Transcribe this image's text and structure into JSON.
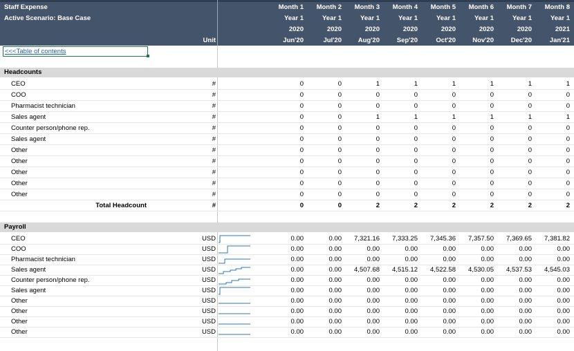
{
  "header": {
    "title": "Staff Expense",
    "scenario": "Active Scenario: Base Case",
    "unit_label": "Unit",
    "months": [
      {
        "m": "Month 1",
        "y": "Year 1",
        "yr": "2020",
        "d": "Jun'20"
      },
      {
        "m": "Month 2",
        "y": "Year 1",
        "yr": "2020",
        "d": "Jul'20"
      },
      {
        "m": "Month 3",
        "y": "Year 1",
        "yr": "2020",
        "d": "Aug'20"
      },
      {
        "m": "Month 4",
        "y": "Year 1",
        "yr": "2020",
        "d": "Sep'20"
      },
      {
        "m": "Month 5",
        "y": "Year 1",
        "yr": "2020",
        "d": "Oct'20"
      },
      {
        "m": "Month 6",
        "y": "Year 1",
        "yr": "2020",
        "d": "Nov'20"
      },
      {
        "m": "Month 7",
        "y": "Year 1",
        "yr": "2020",
        "d": "Dec'20"
      },
      {
        "m": "Month 8",
        "y": "Year 1",
        "yr": "2021",
        "d": "Jan'21"
      }
    ]
  },
  "toc_link": "<<<Table of contents",
  "headcounts": {
    "title": "Headcounts",
    "rows": [
      {
        "label": "CEO",
        "unit": "#",
        "values": [
          "0",
          "0",
          "1",
          "1",
          "1",
          "1",
          "1",
          "1"
        ]
      },
      {
        "label": "COO",
        "unit": "#",
        "values": [
          "0",
          "0",
          "0",
          "0",
          "0",
          "0",
          "0",
          "0"
        ]
      },
      {
        "label": "Pharmacist technician",
        "unit": "#",
        "values": [
          "0",
          "0",
          "0",
          "0",
          "0",
          "0",
          "0",
          "0"
        ]
      },
      {
        "label": "Sales agent",
        "unit": "#",
        "values": [
          "0",
          "0",
          "1",
          "1",
          "1",
          "1",
          "1",
          "1"
        ]
      },
      {
        "label": "Counter person/phone rep.",
        "unit": "#",
        "values": [
          "0",
          "0",
          "0",
          "0",
          "0",
          "0",
          "0",
          "0"
        ]
      },
      {
        "label": "Sales agent",
        "unit": "#",
        "values": [
          "0",
          "0",
          "0",
          "0",
          "0",
          "0",
          "0",
          "0"
        ]
      },
      {
        "label": "Other",
        "unit": "#",
        "values": [
          "0",
          "0",
          "0",
          "0",
          "0",
          "0",
          "0",
          "0"
        ]
      },
      {
        "label": "Other",
        "unit": "#",
        "values": [
          "0",
          "0",
          "0",
          "0",
          "0",
          "0",
          "0",
          "0"
        ]
      },
      {
        "label": "Other",
        "unit": "#",
        "values": [
          "0",
          "0",
          "0",
          "0",
          "0",
          "0",
          "0",
          "0"
        ]
      },
      {
        "label": "Other",
        "unit": "#",
        "values": [
          "0",
          "0",
          "0",
          "0",
          "0",
          "0",
          "0",
          "0"
        ]
      },
      {
        "label": "Other",
        "unit": "#",
        "values": [
          "0",
          "0",
          "0",
          "0",
          "0",
          "0",
          "0",
          "0"
        ]
      }
    ],
    "total": {
      "label": "Total Headcount",
      "unit": "#",
      "values": [
        "0",
        "0",
        "2",
        "2",
        "2",
        "2",
        "2",
        "2"
      ]
    }
  },
  "payroll": {
    "title": "Payroll",
    "rows": [
      {
        "label": "CEO",
        "unit": "USD",
        "spark": "step-high",
        "values": [
          "0.00",
          "0.00",
          "7,321.16",
          "7,333.25",
          "7,345.36",
          "7,357.50",
          "7,369.65",
          "7,381.82"
        ]
      },
      {
        "label": "COO",
        "unit": "USD",
        "spark": "step-late",
        "values": [
          "0.00",
          "0.00",
          "0.00",
          "0.00",
          "0.00",
          "0.00",
          "0.00",
          "0.00"
        ]
      },
      {
        "label": "Pharmacist technician",
        "unit": "USD",
        "spark": "step-mid",
        "values": [
          "0.00",
          "0.00",
          "0.00",
          "0.00",
          "0.00",
          "0.00",
          "0.00",
          "0.00"
        ]
      },
      {
        "label": "Sales agent",
        "unit": "USD",
        "spark": "stairs",
        "values": [
          "0.00",
          "0.00",
          "4,507.68",
          "4,515.12",
          "4,522.58",
          "4,530.05",
          "4,537.53",
          "4,545.03"
        ]
      },
      {
        "label": "Counter person/phone rep.",
        "unit": "USD",
        "spark": "stairs2",
        "values": [
          "0.00",
          "0.00",
          "0.00",
          "0.00",
          "0.00",
          "0.00",
          "0.00",
          "0.00"
        ]
      },
      {
        "label": "Sales agent",
        "unit": "USD",
        "spark": "step-high",
        "values": [
          "0.00",
          "0.00",
          "0.00",
          "0.00",
          "0.00",
          "0.00",
          "0.00",
          "0.00"
        ]
      },
      {
        "label": "Other",
        "unit": "USD",
        "spark": "flat",
        "values": [
          "0.00",
          "0.00",
          "0.00",
          "0.00",
          "0.00",
          "0.00",
          "0.00",
          "0.00"
        ]
      },
      {
        "label": "Other",
        "unit": "USD",
        "spark": "flat",
        "values": [
          "0.00",
          "0.00",
          "0.00",
          "0.00",
          "0.00",
          "0.00",
          "0.00",
          "0.00"
        ]
      },
      {
        "label": "Other",
        "unit": "USD",
        "spark": "flat",
        "values": [
          "0.00",
          "0.00",
          "0.00",
          "0.00",
          "0.00",
          "0.00",
          "0.00",
          "0.00"
        ]
      },
      {
        "label": "Other",
        "unit": "USD",
        "spark": "flat",
        "values": [
          "0.00",
          "0.00",
          "0.00",
          "0.00",
          "0.00",
          "0.00",
          "0.00",
          "0.00"
        ]
      }
    ]
  },
  "colors": {
    "header_bg": "#44546a",
    "section_bg": "#d9d9d9",
    "link": "#2563a6",
    "spark": "#2e75b6"
  }
}
